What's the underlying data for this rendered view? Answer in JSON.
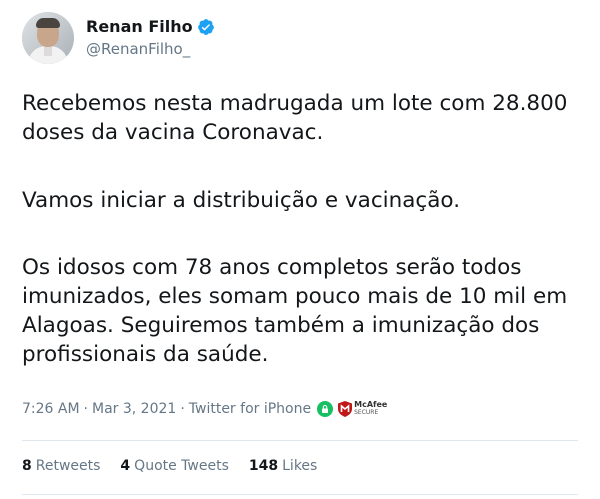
{
  "author": {
    "display_name": "Renan Filho",
    "handle": "@RenanFilho_"
  },
  "tweet": {
    "paragraphs": [
      "Recebemos nesta madrugada um lote com 28.800 doses da vacina Coronavac.",
      "Vamos iniciar a distribuição e vacinação.",
      "Os idosos com 78 anos completos serão todos imunizados, eles somam pouco mais de 10 mil em Alagoas. Seguiremos também a imunização dos profissionais da saúde."
    ],
    "time": "7:26 AM",
    "separator": "·",
    "date": "Mar 3, 2021",
    "source": "Twitter for iPhone"
  },
  "badge": {
    "brand": "McAfee",
    "label": "SECURE"
  },
  "stats": {
    "retweets_count": "8",
    "retweets_label": "Retweets",
    "quote_tweets_count": "4",
    "quote_tweets_label": "Quote Tweets",
    "likes_count": "148",
    "likes_label": "Likes"
  },
  "colors": {
    "text": "#14171a",
    "secondary_text": "#657786",
    "verified": "#1da1f2",
    "lock_badge": "#17bf63",
    "mcafee_red": "#c01818",
    "divider": "#e1e8ed"
  }
}
